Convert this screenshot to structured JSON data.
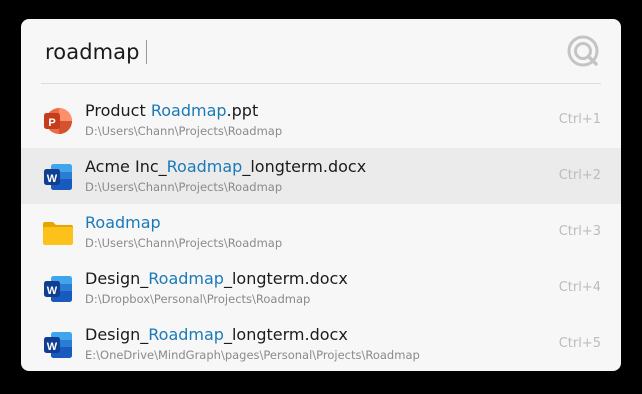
{
  "search": {
    "query": "roadmap"
  },
  "results": [
    {
      "icon": "powerpoint-icon",
      "title_pre": "Product ",
      "title_hl": "Roadmap",
      "title_post": ".ppt",
      "path": "D:\\Users\\Chann\\Projects\\Roadmap",
      "shortcut": "Ctrl+1"
    },
    {
      "icon": "word-icon",
      "title_pre": "Acme Inc_",
      "title_hl": "Roadmap",
      "title_post": "_longterm.docx",
      "path": "D:\\Users\\Chann\\Projects\\Roadmap",
      "shortcut": "Ctrl+2"
    },
    {
      "icon": "folder-icon",
      "title_pre": "",
      "title_hl": "Roadmap",
      "title_post": "",
      "path": "D:\\Users\\Chann\\Projects\\Roadmap",
      "shortcut": "Ctrl+3"
    },
    {
      "icon": "word-icon",
      "title_pre": "Design_",
      "title_hl": "Roadmap",
      "title_post": "_longterm.docx",
      "path": "D:\\Dropbox\\Personal\\Projects\\Roadmap",
      "shortcut": "Ctrl+4"
    },
    {
      "icon": "word-icon",
      "title_pre": "Design_",
      "title_hl": "Roadmap",
      "title_post": "_longterm.docx",
      "path": "E:\\OneDrive\\MindGraph\\pages\\Personal\\Projects\\Roadmap",
      "shortcut": "Ctrl+5"
    }
  ],
  "colors": {
    "highlight": "#1a79b8",
    "selected_row": "#ebebeb",
    "panel": "#f7f7f7"
  }
}
